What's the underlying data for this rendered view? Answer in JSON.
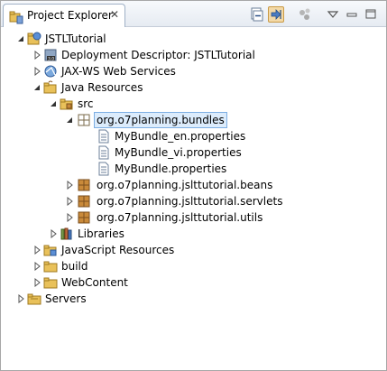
{
  "view": {
    "tab_title": "Project Explorer",
    "toolbar": {
      "collapse_all_icon": "collapse-all-icon",
      "link_with_editor_icon": "link-with-editor-icon",
      "filter_icon": "filter-icon",
      "view_menu_icon": "view-menu-icon",
      "minimize_icon": "minimize-icon",
      "maximize_icon": "maximize-icon"
    }
  },
  "tree": {
    "project": "JSTLTutorial",
    "deployment_descriptor": "Deployment Descriptor: JSTLTutorial",
    "jaxws": "JAX-WS Web Services",
    "java_resources": "Java Resources",
    "src": "src",
    "bundles_pkg": "org.o7planning.bundles",
    "bundle_en": "MyBundle_en.properties",
    "bundle_vi": "MyBundle_vi.properties",
    "bundle_default": "MyBundle.properties",
    "beans_pkg": "org.o7planning.jslttutorial.beans",
    "servlets_pkg": "org.o7planning.jslttutorial.servlets",
    "utils_pkg": "org.o7planning.jslttutorial.utils",
    "libraries": "Libraries",
    "js_resources": "JavaScript Resources",
    "build": "build",
    "webcontent": "WebContent",
    "servers": "Servers"
  },
  "colors": {
    "selection_bg": "#dcecfc",
    "selection_border": "#7daee3",
    "folder": "#e9c15a",
    "package": "#c98a3a"
  }
}
